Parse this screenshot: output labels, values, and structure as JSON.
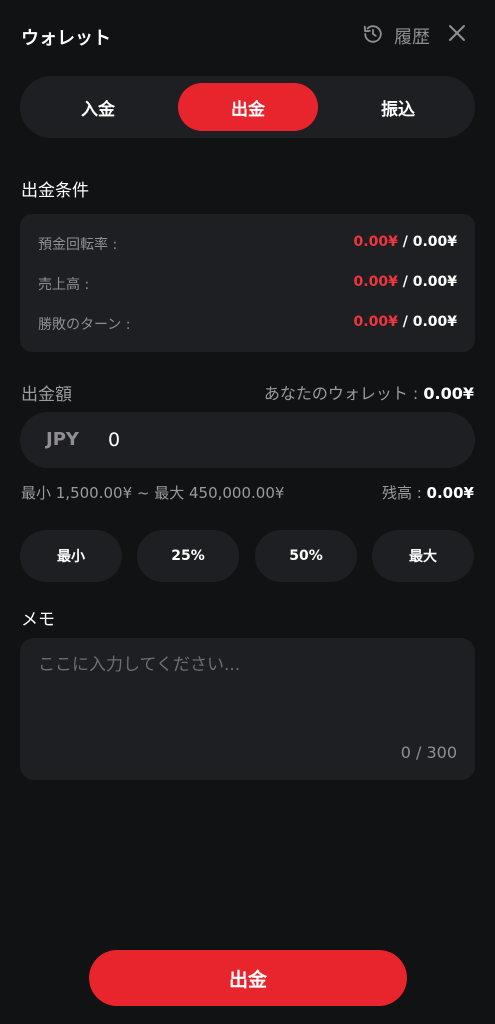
{
  "header": {
    "title": "ウォレット",
    "history_label": "履歴",
    "history_icon": "history-icon",
    "close_icon": "close-icon"
  },
  "tabs": [
    {
      "label": "入金",
      "active": false
    },
    {
      "label": "出金",
      "active": true
    },
    {
      "label": "振込",
      "active": false
    }
  ],
  "conditions": {
    "title": "出金条件",
    "rows": [
      {
        "label": "預金回転率 :",
        "current": "0.00¥",
        "separator": " / ",
        "target": "0.00¥"
      },
      {
        "label": "売上高 :",
        "current": "0.00¥",
        "separator": " / ",
        "target": "0.00¥"
      },
      {
        "label": "勝敗のターン :",
        "current": "0.00¥",
        "separator": " / ",
        "target": "0.00¥"
      }
    ]
  },
  "amount": {
    "label": "出金額",
    "wallet_label": "あなたのウォレット : ",
    "wallet_value": "0.00¥",
    "currency": "JPY",
    "value": "0",
    "limits": "最小 1,500.00¥ ~ 最大 450,000.00¥",
    "balance_label": "残高 : ",
    "balance_value": "0.00¥"
  },
  "quick_buttons": [
    "最小",
    "25%",
    "50%",
    "最大"
  ],
  "memo": {
    "label": "メモ",
    "placeholder": "ここに入力してください...",
    "counter": "0 / 300"
  },
  "submit_label": "出金",
  "colors": {
    "accent": "#e8242d",
    "background": "#111214",
    "card": "#1e1f22",
    "negative_value": "#f0353d"
  }
}
